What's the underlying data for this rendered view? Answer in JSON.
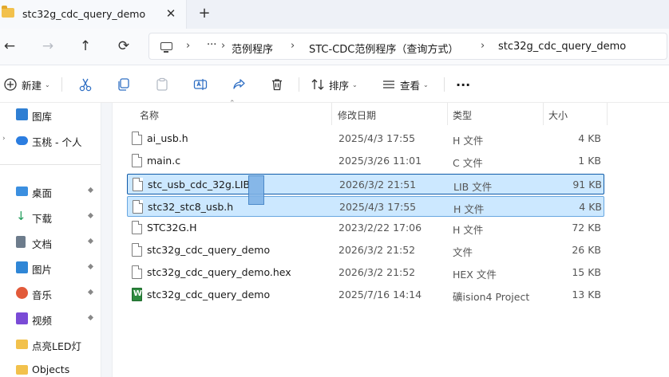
{
  "window": {
    "tab_title": "stc32g_cdc_query_demo",
    "tab_close_glyph": "✕",
    "new_tab_glyph": "+"
  },
  "nav": {
    "back_glyph": "←",
    "forward_glyph": "→",
    "up_glyph": "↑",
    "refresh_glyph": "⟳",
    "breadcrumb_more": "···",
    "breadcrumb_sep": "›",
    "breadcrumbs": [
      "范例程序",
      "STC-CDC范例程序（查询方式）",
      "stc32g_cdc_query_demo"
    ]
  },
  "toolbar": {
    "new_label": "新建",
    "sort_label": "排序",
    "view_label": "查看",
    "more_glyph": "···",
    "caret": "⌄"
  },
  "sidebar": {
    "items": [
      {
        "label": "图库",
        "icon": "gallery-icon",
        "color": "#2f7fd3",
        "pinned": false
      },
      {
        "label": "玉桃 - 个人",
        "icon": "onedrive-icon",
        "color": "#2b7de0",
        "pinned": false
      },
      {
        "label": "桌面",
        "icon": "desktop-icon",
        "color": "#3b8fe0",
        "pinned": true
      },
      {
        "label": "下载",
        "icon": "download-icon",
        "color": "#1f9b5a",
        "pinned": true
      },
      {
        "label": "文档",
        "icon": "documents-icon",
        "color": "#6d7c8c",
        "pinned": true
      },
      {
        "label": "图片",
        "icon": "pictures-icon",
        "color": "#2f86d6",
        "pinned": true
      },
      {
        "label": "音乐",
        "icon": "music-icon",
        "color": "#e25a3a",
        "pinned": true
      },
      {
        "label": "视频",
        "icon": "videos-icon",
        "color": "#7a4bd6",
        "pinned": true
      },
      {
        "label": "点亮LED灯",
        "icon": "folder-icon",
        "color": "#f2c14c",
        "pinned": false
      },
      {
        "label": "Objects",
        "icon": "folder-icon",
        "color": "#f2c14c",
        "pinned": false
      }
    ],
    "pin_glyph": "📌",
    "expand_glyph": "›"
  },
  "columns": {
    "name": "名称",
    "date": "修改日期",
    "type": "类型",
    "size": "大小",
    "sort_glyph": "⌃"
  },
  "files": [
    {
      "name": "ai_usb.h",
      "date": "2025/4/3 17:55",
      "type": "H 文件",
      "size": "4 KB",
      "icon": "file-icon"
    },
    {
      "name": "main.c",
      "date": "2025/3/26 11:01",
      "type": "C 文件",
      "size": "1 KB",
      "icon": "file-icon"
    },
    {
      "name": "stc_usb_cdc_32g.LIB",
      "date": "2026/3/2 21:51",
      "type": "LIB 文件",
      "size": "91 KB",
      "icon": "file-icon",
      "state": "selected"
    },
    {
      "name": "stc32_stc8_usb.h",
      "date": "2025/4/3 17:55",
      "type": "H 文件",
      "size": "4 KB",
      "icon": "file-icon",
      "state": "selected2"
    },
    {
      "name": "STC32G.H",
      "date": "2023/2/22 17:06",
      "type": "H 文件",
      "size": "72 KB",
      "icon": "file-icon"
    },
    {
      "name": "stc32g_cdc_query_demo",
      "date": "2026/3/2 21:52",
      "type": "文件",
      "size": "26 KB",
      "icon": "file-icon"
    },
    {
      "name": "stc32g_cdc_query_demo.hex",
      "date": "2026/3/2 21:52",
      "type": "HEX 文件",
      "size": "15 KB",
      "icon": "file-icon"
    },
    {
      "name": "stc32g_cdc_query_demo",
      "date": "2025/7/16 14:14",
      "type": "礦ision4 Project",
      "size": "13 KB",
      "icon": "keil-project-icon"
    }
  ]
}
